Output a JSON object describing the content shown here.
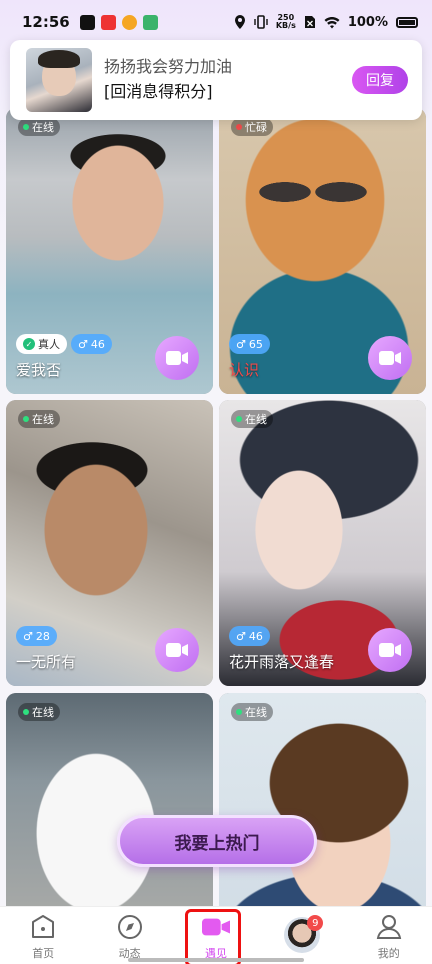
{
  "status_bar": {
    "time": "12:56",
    "net_speed": "250\nKB/s",
    "battery": "100%"
  },
  "notification": {
    "name": "扬扬我会努力加油",
    "message": "[回消息得积分]",
    "reply_label": "回复"
  },
  "cards": [
    {
      "status": "在线",
      "real_tag": "真人",
      "age": "46",
      "name": "爱我否",
      "online_color": "#2ee07f"
    },
    {
      "status": "忙碌",
      "real_tag": "",
      "age": "65",
      "name": "认识",
      "online_color": "#f04a4a"
    },
    {
      "status": "在线",
      "real_tag": "",
      "age": "28",
      "name": "一无所有",
      "online_color": "#2ee07f"
    },
    {
      "status": "在线",
      "real_tag": "",
      "age": "46",
      "name": "花开雨落又逢春",
      "online_color": "#2ee07f"
    },
    {
      "status": "在线",
      "real_tag": "",
      "age": "",
      "name": "",
      "online_color": "#2ee07f"
    },
    {
      "status": "在线",
      "real_tag": "",
      "age": "",
      "name": "",
      "online_color": "#2ee07f"
    }
  ],
  "hot_button_label": "我要上热门",
  "nav": {
    "home": "首页",
    "feed": "动态",
    "meet": "遇见",
    "messages_badge": "9",
    "mine": "我的"
  },
  "colors": {
    "accent": "#d34bef",
    "button_gradient_start": "#d957f2",
    "button_gradient_end": "#b042e8"
  }
}
